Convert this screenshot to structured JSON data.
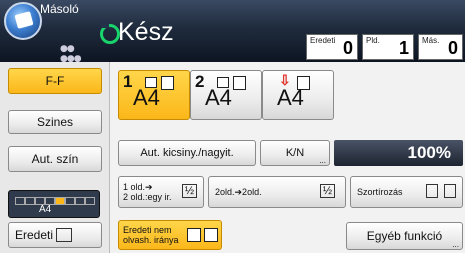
{
  "header": {
    "app_title": "Másoló",
    "status": "Kész",
    "counters": [
      {
        "label": "Eredeti",
        "value": "0"
      },
      {
        "label": "Pld.",
        "value": "1"
      },
      {
        "label": "Más.",
        "value": "0"
      }
    ]
  },
  "left_buttons": {
    "mode": "F-F",
    "color": "Szines",
    "auto_color": "Aut. szín",
    "density_label": "A4",
    "original": "Eredeti"
  },
  "paper": [
    {
      "num": "1",
      "size": "A4",
      "selected": true
    },
    {
      "num": "2",
      "size": "A4",
      "selected": false
    },
    {
      "num": "",
      "size": "A4",
      "selected": false
    }
  ],
  "reduce_enlarge": {
    "auto": "Aut. kicsiny./nagyit.",
    "kn": "K/N",
    "kn_sub": "...",
    "zoom": "100%"
  },
  "duplex": {
    "one_sided_l1": "1 old.➔",
    "one_sided_l2": "2 old.:egy ir.",
    "two_sided": "2old.➔2old.",
    "sort": "Szortírozás"
  },
  "bottom": {
    "orient_l1": "Eredeti nem",
    "orient_l2": "olvash. iránya",
    "other": "Egyéb funkció",
    "other_sub": "..."
  },
  "colors": {
    "accent": "#fbb71a",
    "ready": "#19d36b",
    "header": "#1f2b3d"
  }
}
